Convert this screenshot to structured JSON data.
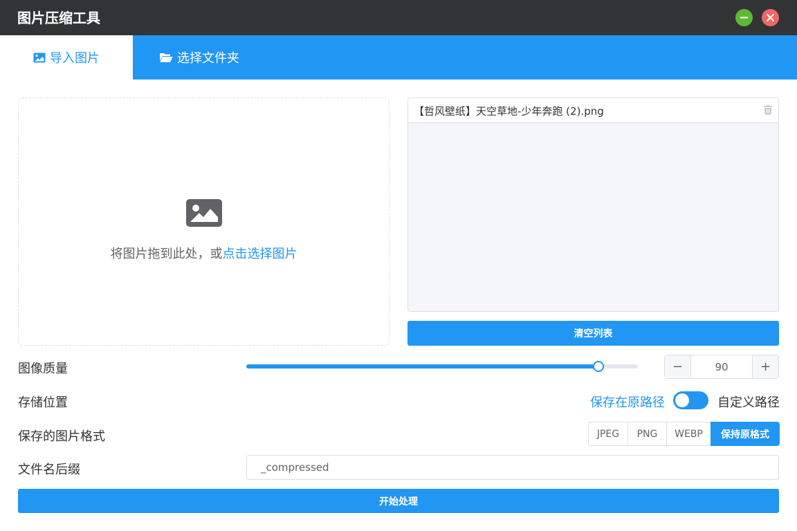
{
  "app": {
    "title": "图片压缩工具"
  },
  "tabs": [
    {
      "label": "导入图片",
      "icon": "image-icon",
      "active": true
    },
    {
      "label": "选择文件夹",
      "icon": "folder-open-icon",
      "active": false
    }
  ],
  "dropzone": {
    "icon": "image-icon",
    "text": "将图片拖到此处，或",
    "link": "点击选择图片"
  },
  "file_list": {
    "items": [
      {
        "name": "【哲风壁纸】天空草地-少年奔跑 (2).png"
      }
    ],
    "clear_label": "清空列表"
  },
  "settings": {
    "quality": {
      "label": "图像质量",
      "value": "90",
      "slider_fraction": 0.9,
      "dec_label": "−",
      "inc_label": "+"
    },
    "storage": {
      "label": "存储位置",
      "option_original": "保存在原路径",
      "option_custom": "自定义路径"
    },
    "format": {
      "label": "保存的图片格式",
      "options": [
        "JPEG",
        "PNG",
        "WEBP",
        "保持原格式"
      ],
      "selected": "保持原格式"
    },
    "suffix": {
      "label": "文件名后缀",
      "value": "_compressed"
    }
  },
  "start_label": "开始处理",
  "colors": {
    "titlebar": "#323335",
    "accent": "#2196f3",
    "minimize": "#5cb934",
    "close": "#ef6767"
  }
}
